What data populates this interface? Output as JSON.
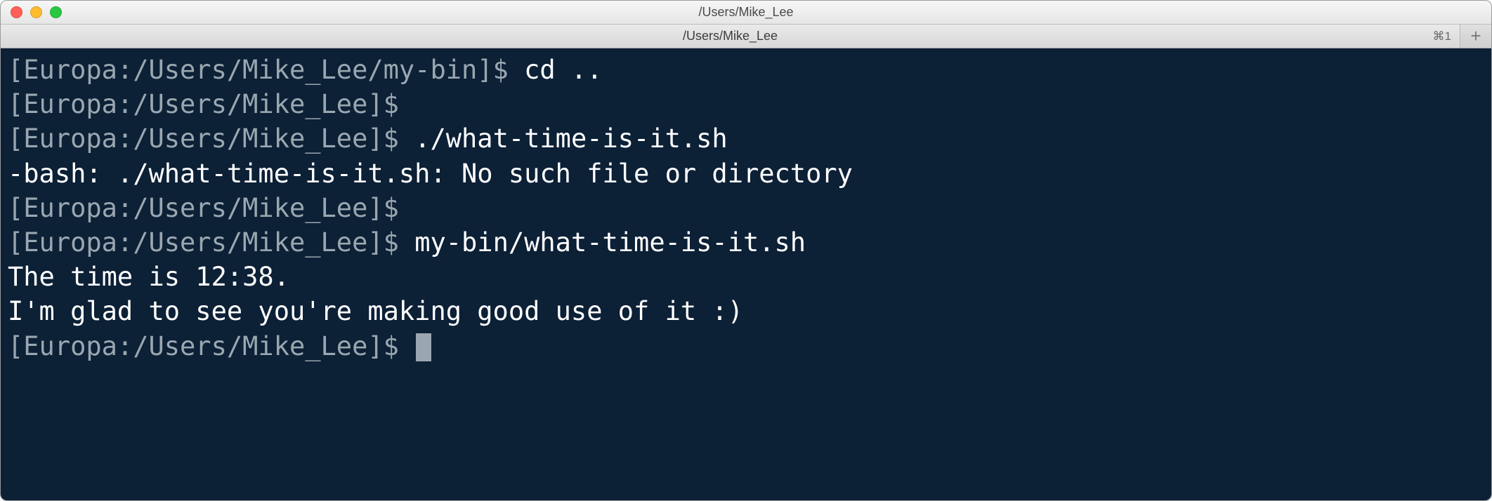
{
  "window": {
    "title": "/Users/Mike_Lee"
  },
  "tabbar": {
    "tab_title": "/Users/Mike_Lee",
    "shortcut": "⌘1",
    "newtab_glyph": "+"
  },
  "terminal": {
    "lines": [
      {
        "prompt": "[Europa:/Users/Mike_Lee/my-bin]$ ",
        "cmd": "cd .."
      },
      {
        "prompt": "[Europa:/Users/Mike_Lee]$ ",
        "cmd": ""
      },
      {
        "prompt": "[Europa:/Users/Mike_Lee]$ ",
        "cmd": "./what-time-is-it.sh"
      },
      {
        "out": "-bash: ./what-time-is-it.sh: No such file or directory"
      },
      {
        "prompt": "[Europa:/Users/Mike_Lee]$ ",
        "cmd": ""
      },
      {
        "prompt": "[Europa:/Users/Mike_Lee]$ ",
        "cmd": "my-bin/what-time-is-it.sh"
      },
      {
        "out": "The time is 12:38."
      },
      {
        "out": "I'm glad to see you're making good use of it :)"
      },
      {
        "prompt": "[Europa:/Users/Mike_Lee]$ ",
        "cursor": true
      }
    ]
  }
}
